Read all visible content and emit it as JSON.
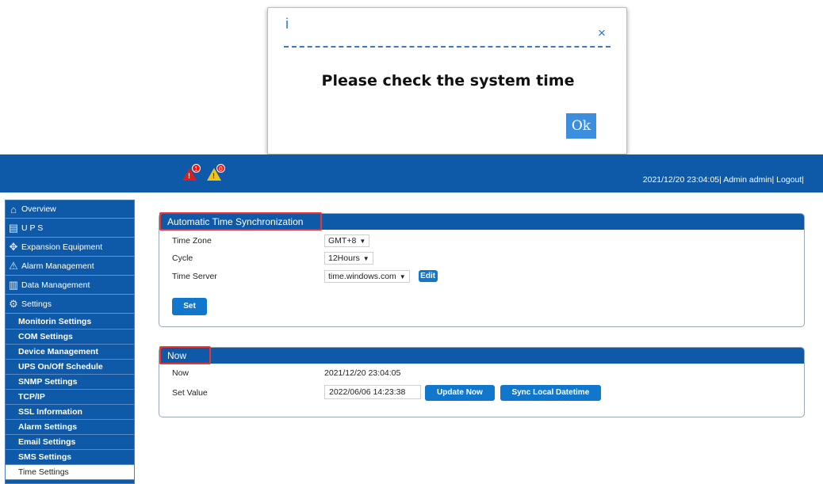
{
  "dialog": {
    "icon": "i",
    "close_symbol": "×",
    "message": "Please check the system time",
    "ok_label": "Ok"
  },
  "header": {
    "alarms": [
      {
        "color": "#e31b1b",
        "count": "1",
        "mark": "!"
      },
      {
        "color": "#f0c419",
        "count": "0",
        "mark": "!"
      }
    ],
    "datetime": "2021/12/20 23:04:05",
    "user": "Admin admin",
    "logout": "Logout"
  },
  "sidebar": {
    "items": [
      {
        "label": "Overview",
        "icon": "home-icon"
      },
      {
        "label": "U P S",
        "icon": "ups-icon"
      },
      {
        "label": "Expansion Equipment",
        "icon": "expansion-icon"
      },
      {
        "label": "Alarm Management",
        "icon": "warning-icon"
      },
      {
        "label": "Data Management",
        "icon": "database-icon"
      },
      {
        "label": "Settings",
        "icon": "gear-icon"
      }
    ],
    "sub_items": [
      "Monitorin Settings",
      "COM Settings",
      "Device Management",
      "UPS On/Off Schedule",
      "SNMP Settings",
      "TCP/IP",
      "SSL Information",
      "Alarm Settings",
      "Email Settings",
      "SMS Settings",
      "Time Settings"
    ]
  },
  "auto_sync": {
    "title": "Automatic Time Synchronization",
    "time_zone_label": "Time Zone",
    "time_zone_value": "GMT+8",
    "cycle_label": "Cycle",
    "cycle_value": "12Hours",
    "server_label": "Time Server",
    "server_value": "time.windows.com",
    "edit_label": "Edit",
    "set_label": "Set"
  },
  "now_panel": {
    "title": "Now",
    "now_label": "Now",
    "now_value": "2021/12/20 23:04:05",
    "set_value_label": "Set Value",
    "set_value": "2022/06/06 14:23:38",
    "update_label": "Update Now",
    "sync_label": "Sync Local Datetime"
  },
  "colors": {
    "brand_blue": "#0e5aa8",
    "highlight_red": "#e33"
  }
}
